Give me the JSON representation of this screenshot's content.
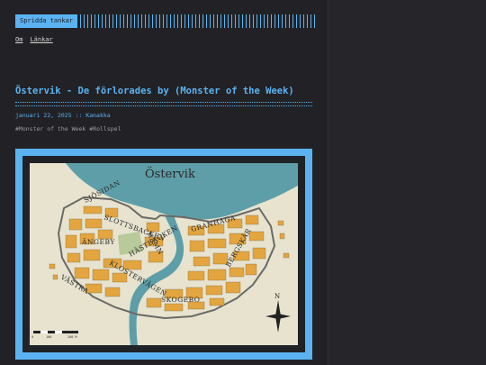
{
  "site": {
    "logo_text": "Spridda tankar",
    "nav": [
      {
        "label": "Om"
      },
      {
        "label": "Länkar"
      }
    ]
  },
  "post": {
    "title": "Östervik - De förlorades by (Monster of the Week)",
    "date": "januari 22, 2025",
    "separator": "::",
    "author": "Kanakka",
    "tags": [
      "#Monster of the Week",
      "#Rollspel"
    ]
  },
  "map": {
    "title": "Östervik",
    "districts": [
      "SJÖSIDAN",
      "SLOTTSBACKEN",
      "ÄNGEBY",
      "HAMN",
      "GRANHAGA",
      "KLOSTERVÄGEN",
      "HÄSTBACKEN",
      "VÄSTRA",
      "SKOGEBO",
      "BERGSKÄR"
    ],
    "compass_label": "N",
    "scale_labels": [
      "0",
      "100",
      "200 M"
    ],
    "colors": {
      "water": "#5e9ea8",
      "land": "#e7e3cf",
      "park": "#b8c99a",
      "buildings": "#e3a53f",
      "walls": "#6a6a66"
    }
  }
}
